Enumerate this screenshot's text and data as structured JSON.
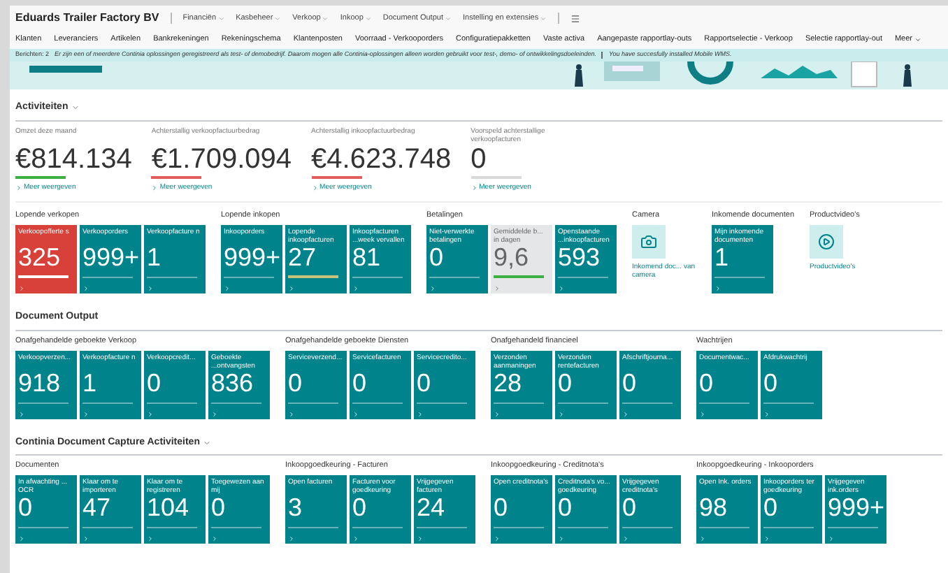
{
  "header": {
    "company": "Eduards Trailer Factory BV",
    "menus": [
      "Financiën",
      "Kasbeheer",
      "Verkoop",
      "Inkoop",
      "Document Output",
      "Instelling en extensies"
    ]
  },
  "nav_links": [
    "Klanten",
    "Leveranciers",
    "Artikelen",
    "Bankrekeningen",
    "Rekeningschema",
    "Klantenposten",
    "Voorraad - Verkooporders",
    "Configuratiepakketten",
    "Vaste activa",
    "Aangepaste rapportlay-outs",
    "Rapportselectie - Verkoop",
    "Selectie rapportlay-out",
    "Meer"
  ],
  "message_bar": {
    "label": "Berichten: 2",
    "messages": [
      "Er zijn een of meerdere Continia oplossingen geregistreerd als test- of demobedrijf. Daarom mogen alle Continia-oplossingen alleen worden gebruikt voor test-, demo- of ontwikkelingsdoeleinden.",
      "You have succesfully installed Mobile WMS."
    ]
  },
  "activities": {
    "title": "Activiteiten",
    "kpis": [
      {
        "label": "Omzet deze maand",
        "value": "€814.134",
        "color": "#3cb043",
        "link": "Meer weergeven"
      },
      {
        "label": "Achterstallig verkoopfactuurbedrag",
        "value": "€1.709.094",
        "color": "#e35d5d",
        "link": "Meer weergeven"
      },
      {
        "label": "Achterstallig inkoopfactuurbedrag",
        "value": "€4.623.748",
        "color": "#e35d5d",
        "link": "Meer weergeven"
      },
      {
        "label": "Voorspeld achterstallige verkoopfacturen",
        "value": "0",
        "color": "#d9d9d9",
        "link": "Meer weergeven"
      }
    ],
    "groups": [
      {
        "title": "Lopende verkopen",
        "tiles": [
          {
            "kind": "alert",
            "label": "Verkoopofferte s",
            "value": "325",
            "color": "#ffffff"
          },
          {
            "kind": "normal",
            "label": "Verkooporders",
            "value": "999+"
          },
          {
            "kind": "normal",
            "label": "Verkoopfacture n",
            "value": "1"
          }
        ]
      },
      {
        "title": "Lopende inkopen",
        "tiles": [
          {
            "kind": "normal",
            "label": "Inkooporders",
            "value": "999+"
          },
          {
            "kind": "normal",
            "label": "Lopende inkoopfacturen",
            "value": "27",
            "color": "#c9c27a"
          },
          {
            "kind": "normal",
            "label": "Inkoopfacturen ...week vervallen",
            "value": "81"
          }
        ]
      },
      {
        "title": "Betalingen",
        "tiles": [
          {
            "kind": "normal",
            "label": "Niet-verwerkte betalingen",
            "value": "0"
          },
          {
            "kind": "neutral",
            "label": "Gemiddelde b... in dagen",
            "value": "9,6",
            "color": "#3cb043"
          },
          {
            "kind": "normal",
            "label": "Openstaande ...inkoopfacturen",
            "value": "593"
          }
        ]
      },
      {
        "title": "Camera",
        "tiles": [
          {
            "kind": "camera",
            "label": "Inkomend doc... van camera"
          }
        ]
      },
      {
        "title": "Inkomende documenten",
        "tiles": [
          {
            "kind": "normal",
            "label": "Mijn inkomende documenten",
            "value": "1"
          }
        ]
      },
      {
        "title": "Productvideo's",
        "tiles": [
          {
            "kind": "video",
            "label": "Productvideo's"
          }
        ]
      }
    ]
  },
  "sections": [
    {
      "title": "Document Output",
      "groups": [
        {
          "title": "Onafgehandelde geboekte Verkoop",
          "tiles": [
            {
              "kind": "normal",
              "label": "Verkoopverzen...",
              "value": "918"
            },
            {
              "kind": "normal",
              "label": "Verkoopfacture n",
              "value": "1"
            },
            {
              "kind": "normal",
              "label": "Verkoopcredit...",
              "value": "0"
            },
            {
              "kind": "normal",
              "label": "Geboekte ...ontvangsten",
              "value": "836"
            }
          ]
        },
        {
          "title": "Onafgehandelde geboekte Diensten",
          "tiles": [
            {
              "kind": "normal",
              "label": "Serviceverzend...",
              "value": "0"
            },
            {
              "kind": "normal",
              "label": "Servicefacturen",
              "value": "0"
            },
            {
              "kind": "normal",
              "label": "Servicecredito...",
              "value": "0"
            }
          ]
        },
        {
          "title": "Onafgehandeld financieel",
          "tiles": [
            {
              "kind": "normal",
              "label": "Verzonden aanmaningen",
              "value": "28"
            },
            {
              "kind": "normal",
              "label": "Verzonden rentefacturen",
              "value": "0"
            },
            {
              "kind": "normal",
              "label": "Afschriftjourna...",
              "value": "0"
            }
          ]
        },
        {
          "title": "Wachtrijen",
          "tiles": [
            {
              "kind": "normal",
              "label": "Documentwac...",
              "value": "0"
            },
            {
              "kind": "normal",
              "label": "Afdrukwachtrij",
              "value": "0"
            }
          ]
        }
      ]
    },
    {
      "title": "Continia Document Capture Activiteiten",
      "groups": [
        {
          "title": "Documenten",
          "tiles": [
            {
              "kind": "normal",
              "label": "In afwachting ... OCR",
              "value": "0"
            },
            {
              "kind": "normal",
              "label": "Klaar om te importeren",
              "value": "47"
            },
            {
              "kind": "normal",
              "label": "Klaar om te registreren",
              "value": "104"
            },
            {
              "kind": "normal",
              "label": "Toegewezen aan mij",
              "value": "0"
            }
          ]
        },
        {
          "title": "Inkoopgoedkeuring - Facturen",
          "tiles": [
            {
              "kind": "normal",
              "label": "Open facturen",
              "value": "3"
            },
            {
              "kind": "normal",
              "label": "Facturen voor goedkeuring",
              "value": "0"
            },
            {
              "kind": "normal",
              "label": "Vrijgegeven facturen",
              "value": "24"
            }
          ]
        },
        {
          "title": "Inkoopgoedkeuring - Creditnota's",
          "tiles": [
            {
              "kind": "normal",
              "label": "Open creditnota's",
              "value": "0"
            },
            {
              "kind": "normal",
              "label": "Creditnota's vo... goedkeuring",
              "value": "0"
            },
            {
              "kind": "normal",
              "label": "Vrijgegeven creditnota's",
              "value": "0"
            }
          ]
        },
        {
          "title": "Inkoopgoedkeuring - Inkooporders",
          "tiles": [
            {
              "kind": "normal",
              "label": "Open Ink. orders",
              "value": "98"
            },
            {
              "kind": "normal",
              "label": "Inkooporders ter goedkeuring",
              "value": "0"
            },
            {
              "kind": "normal",
              "label": "Vrijgegeven ink.orders",
              "value": "999+"
            }
          ]
        }
      ]
    }
  ]
}
